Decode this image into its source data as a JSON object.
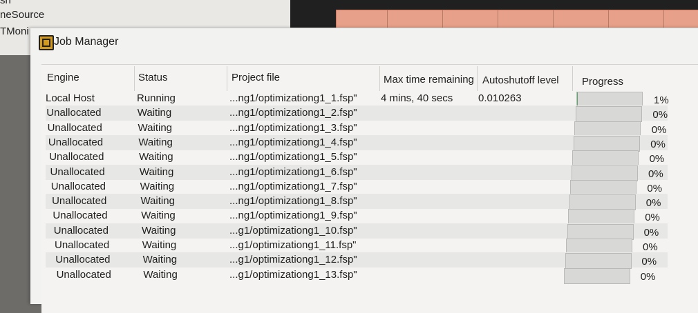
{
  "background": {
    "left_lines": [
      "sh",
      "neSource",
      "TMoni"
    ]
  },
  "window": {
    "title": "Job Manager",
    "columns": {
      "engine": "Engine",
      "status": "Status",
      "project_file": "Project file",
      "max_time": "Max time remaining",
      "autoshutoff": "Autoshutoff level",
      "progress": "Progress"
    },
    "jobs": [
      {
        "engine": "Local Host",
        "status": "Running",
        "file": "...ng1/optimizationg1_1.fsp\"",
        "time": "4 mins, 40 secs",
        "autoshutoff": "0.010263",
        "progress": "1%",
        "progress_value": 0.01
      },
      {
        "engine": "Unallocated",
        "status": "Waiting",
        "file": "...ng1/optimizationg1_2.fsp\"",
        "time": "",
        "autoshutoff": "",
        "progress": "0%",
        "progress_value": 0
      },
      {
        "engine": "Unallocated",
        "status": "Waiting",
        "file": "...ng1/optimizationg1_3.fsp\"",
        "time": "",
        "autoshutoff": "",
        "progress": "0%",
        "progress_value": 0
      },
      {
        "engine": "Unallocated",
        "status": "Waiting",
        "file": "...ng1/optimizationg1_4.fsp\"",
        "time": "",
        "autoshutoff": "",
        "progress": "0%",
        "progress_value": 0
      },
      {
        "engine": "Unallocated",
        "status": "Waiting",
        "file": "...ng1/optimizationg1_5.fsp\"",
        "time": "",
        "autoshutoff": "",
        "progress": "0%",
        "progress_value": 0
      },
      {
        "engine": "Unallocated",
        "status": "Waiting",
        "file": "...ng1/optimizationg1_6.fsp\"",
        "time": "",
        "autoshutoff": "",
        "progress": "0%",
        "progress_value": 0
      },
      {
        "engine": "Unallocated",
        "status": "Waiting",
        "file": "...ng1/optimizationg1_7.fsp\"",
        "time": "",
        "autoshutoff": "",
        "progress": "0%",
        "progress_value": 0
      },
      {
        "engine": "Unallocated",
        "status": "Waiting",
        "file": "...ng1/optimizationg1_8.fsp\"",
        "time": "",
        "autoshutoff": "",
        "progress": "0%",
        "progress_value": 0
      },
      {
        "engine": "Unallocated",
        "status": "Waiting",
        "file": "...ng1/optimizationg1_9.fsp\"",
        "time": "",
        "autoshutoff": "",
        "progress": "0%",
        "progress_value": 0
      },
      {
        "engine": "Unallocated",
        "status": "Waiting",
        "file": "...g1/optimizationg1_10.fsp\"",
        "time": "",
        "autoshutoff": "",
        "progress": "0%",
        "progress_value": 0
      },
      {
        "engine": "Unallocated",
        "status": "Waiting",
        "file": "...g1/optimizationg1_11.fsp\"",
        "time": "",
        "autoshutoff": "",
        "progress": "0%",
        "progress_value": 0
      },
      {
        "engine": "Unallocated",
        "status": "Waiting",
        "file": "...g1/optimizationg1_12.fsp\"",
        "time": "",
        "autoshutoff": "",
        "progress": "0%",
        "progress_value": 0
      },
      {
        "engine": "Unallocated",
        "status": "Waiting",
        "file": "...g1/optimizationg1_13.fsp\"",
        "time": "",
        "autoshutoff": "",
        "progress": "0%",
        "progress_value": 0
      }
    ]
  }
}
